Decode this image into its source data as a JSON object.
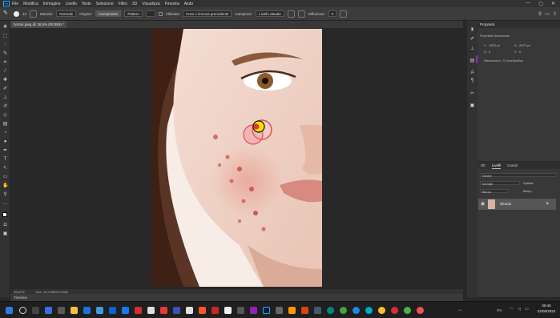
{
  "menu": {
    "app_icon": "Ps",
    "items": [
      "File",
      "Modifica",
      "Immagine",
      "Livello",
      "Testo",
      "Selezione",
      "Filtro",
      "3D",
      "Visualizza",
      "Finestra",
      "Aiuto"
    ],
    "window_controls": [
      "—",
      "▢",
      "✕"
    ]
  },
  "options": {
    "size_value": "13",
    "mode_label": "Metodo:",
    "mode_value": "Normale",
    "source_label": "Origine:",
    "source_sampled": "Campionato",
    "source_pattern": "Pattern",
    "aligned_label": "Allineato",
    "sample_label": "Campione:",
    "sample_value": "Livello attuale",
    "diffusion_label": "Diffusione:",
    "diffusion_value": "5",
    "pattern_option": "Crea o rinnova precedente"
  },
  "document": {
    "tab_label": "bortok.jpeg @ 36,5% (RGB/8) *",
    "zoom": "36,67%",
    "doc_info": "Doc: 10,6 MB/10,6 MB"
  },
  "timeline_label": "Timeline",
  "properties": {
    "title": "Proprietà",
    "section": "Proprietà documento",
    "width_label": "L:",
    "width_value": "1920 px",
    "height_label": "A:",
    "height_value": "2879 px",
    "x_label": "X:",
    "x_value": "0",
    "y_label": "Y:",
    "y_value": "0",
    "resolution": "Risoluzione: 72 pixel/pollice"
  },
  "layers": {
    "tabs": [
      "3D",
      "Livelli",
      "Canali"
    ],
    "filter_kind": "Genere",
    "blend_mode": "Normale",
    "opacity": "Opacità:",
    "lock_label": "Blocca:",
    "fill_label": "Riemp.:",
    "layer_name": "Sfondo"
  },
  "taskbar": {
    "time": "09:40",
    "date": "22/05/2022",
    "lang": "ITA"
  },
  "colors": {
    "accent": "#31a8ff",
    "taskbar": "#1f1f1f",
    "panel": "#383838"
  }
}
